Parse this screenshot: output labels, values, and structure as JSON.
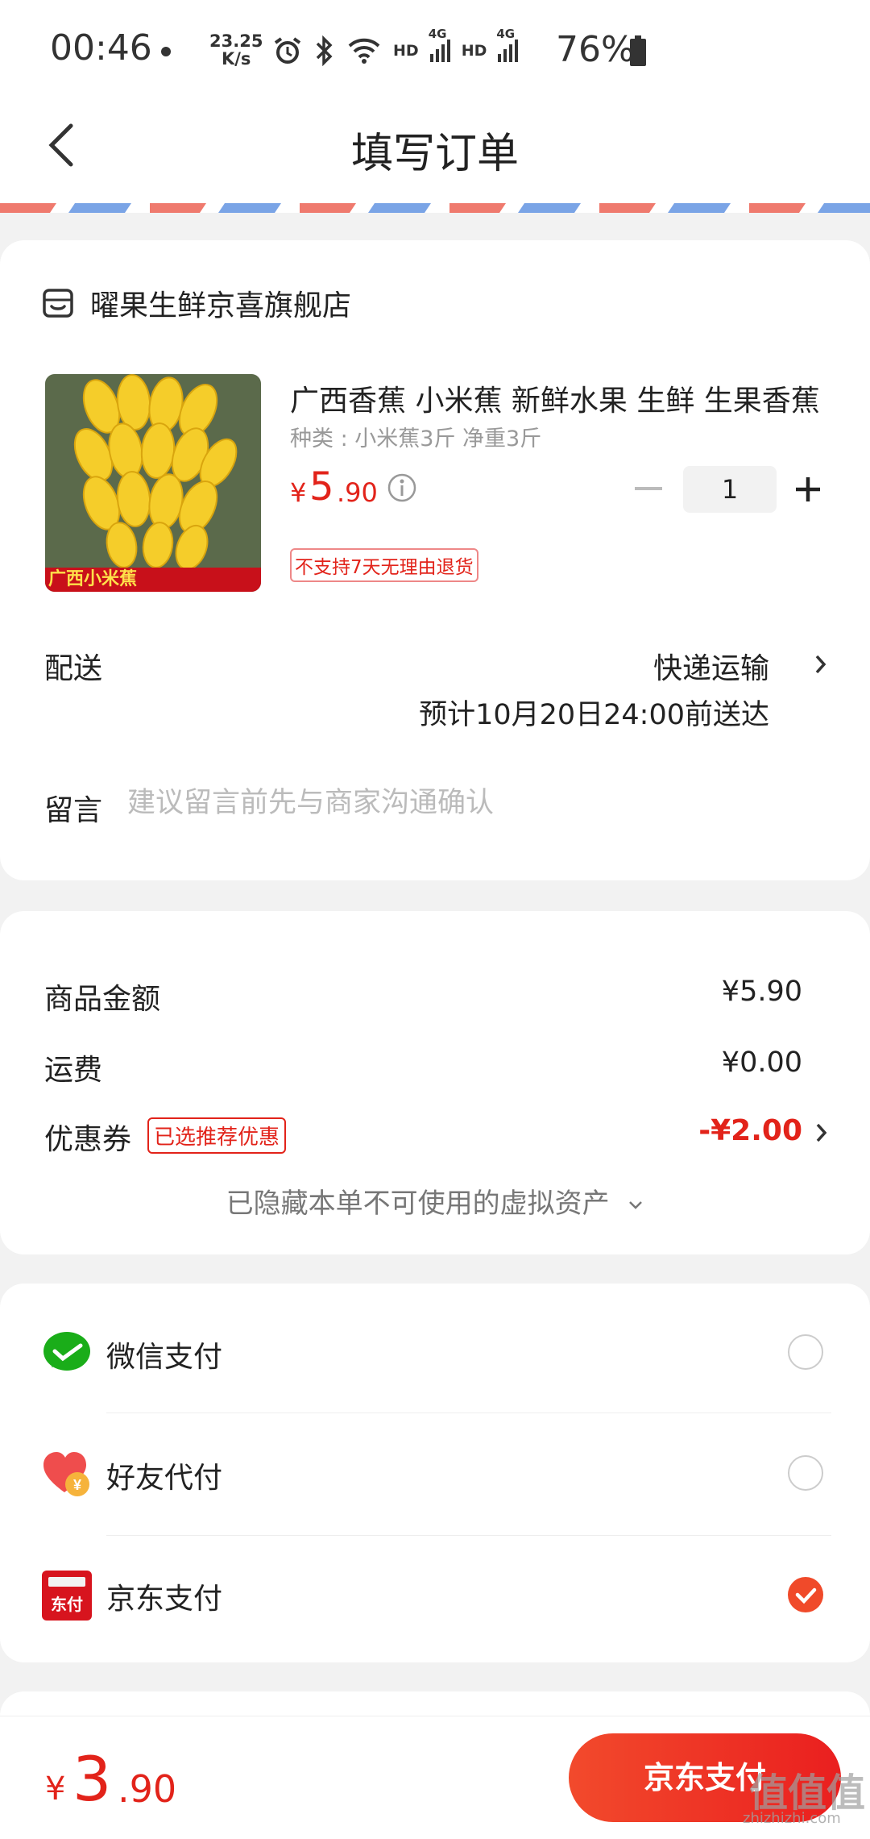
{
  "status_bar": {
    "time": "00:46",
    "net_speed_value": "23.25",
    "net_speed_unit": "K/s",
    "signal_label_1": "HD",
    "signal_gen_1": "4G",
    "signal_label_2": "HD",
    "signal_gen_2": "4G",
    "battery": "76%"
  },
  "nav": {
    "title": "填写订单"
  },
  "store": {
    "name": "曜果生鲜京喜旗舰店"
  },
  "product": {
    "title": "广西香蕉 小米蕉   新鲜水果 生鲜 生果香蕉",
    "spec": "种类 : 小米蕉3斤 净重3斤",
    "price_currency": "¥",
    "price_int": "5",
    "price_dec": ".90",
    "quantity": "1",
    "return_policy": "不支持7天无理由退货",
    "image_caption": "广西小米蕉"
  },
  "delivery": {
    "label": "配送",
    "method": "快递运输",
    "eta": "预计10月20日24:00前送达"
  },
  "note": {
    "label": "留言",
    "placeholder": "建议留言前先与商家沟通确认"
  },
  "summary": {
    "goods_label": "商品金额",
    "goods_value": "¥5.90",
    "shipping_label": "运费",
    "shipping_value": "¥0.00",
    "coupon_label": "优惠券",
    "coupon_badge": "已选推荐优惠",
    "coupon_value": "-¥2.00",
    "hidden_assets": "已隐藏本单不可使用的虚拟资产"
  },
  "payment": {
    "options": [
      {
        "label": "微信支付",
        "selected": false
      },
      {
        "label": "好友代付",
        "selected": false
      },
      {
        "label": "京东支付",
        "selected": true
      }
    ],
    "jd_icon_text": "东付"
  },
  "footer": {
    "total_currency": "¥",
    "total_int": "3",
    "total_dec": ".90",
    "pay_button": "京东支付",
    "watermark": "值值值",
    "watermark_sub": "zhizhizhi.com"
  },
  "colors": {
    "accent_red": "#e2231a",
    "pay_orange": "#f04a2a",
    "wechat_green": "#1aad19"
  }
}
